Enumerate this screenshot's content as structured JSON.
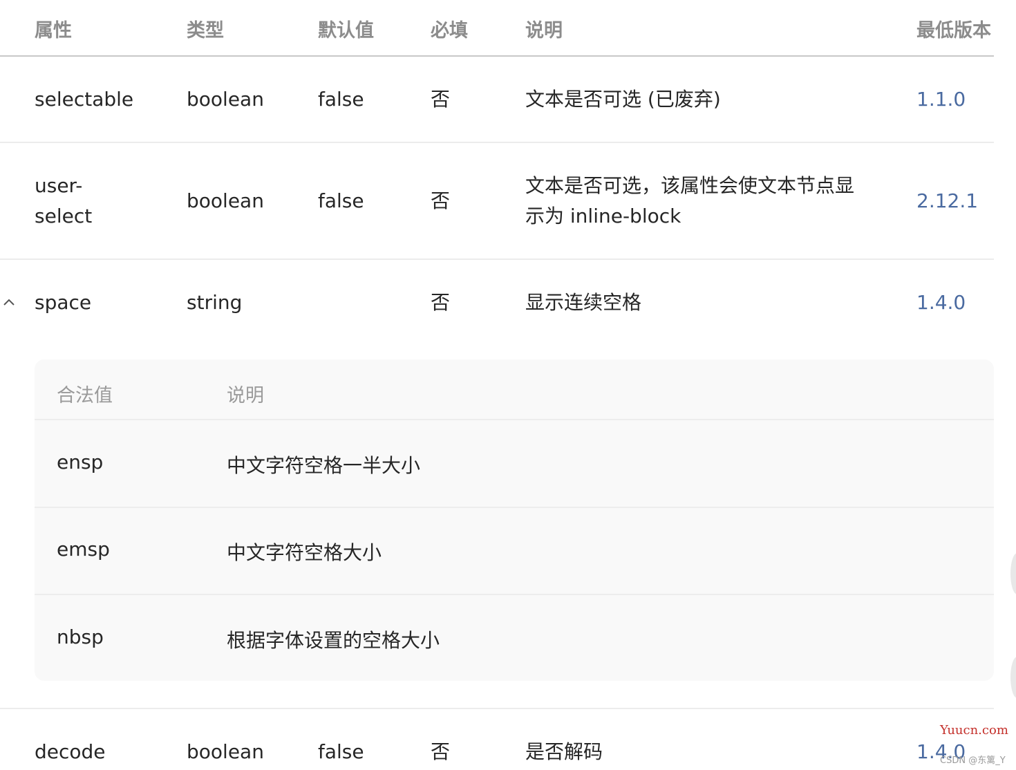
{
  "headers": {
    "attr": "属性",
    "type": "类型",
    "default": "默认值",
    "required": "必填",
    "desc": "说明",
    "version": "最低版本"
  },
  "rows": [
    {
      "attr": "selectable",
      "type": "boolean",
      "default": "false",
      "required": "否",
      "desc": "文本是否可选 (已废弃)",
      "version": "1.1.0"
    },
    {
      "attr_line1": "user-",
      "attr_line2": "select",
      "type": "boolean",
      "default": "false",
      "required": "否",
      "desc_line1": "文本是否可选，该属性会使文本节点显",
      "desc_line2": "示为 inline-block",
      "version": "2.12.1"
    },
    {
      "attr": "space",
      "type": "string",
      "default": "",
      "required": "否",
      "desc": "显示连续空格",
      "version": "1.4.0"
    },
    {
      "attr": "decode",
      "type": "boolean",
      "default": "false",
      "required": "否",
      "desc": "是否解码",
      "version": "1.4.0"
    }
  ],
  "space_values": {
    "header_value": "合法值",
    "header_desc": "说明",
    "items": [
      {
        "value": "ensp",
        "desc": "中文字符空格一半大小"
      },
      {
        "value": "emsp",
        "desc": "中文字符空格大小"
      },
      {
        "value": "nbsp",
        "desc": "根据字体设置的空格大小"
      }
    ]
  },
  "icons": {
    "expand_toggle": "chevron-up-icon"
  },
  "watermark": {
    "site": "Yuucn.com",
    "credit": "CSDN @东篱_Y"
  },
  "colors": {
    "version_link": "#4a6aa0",
    "header_text": "#8c8c8c",
    "watermark": "#c4302b"
  }
}
